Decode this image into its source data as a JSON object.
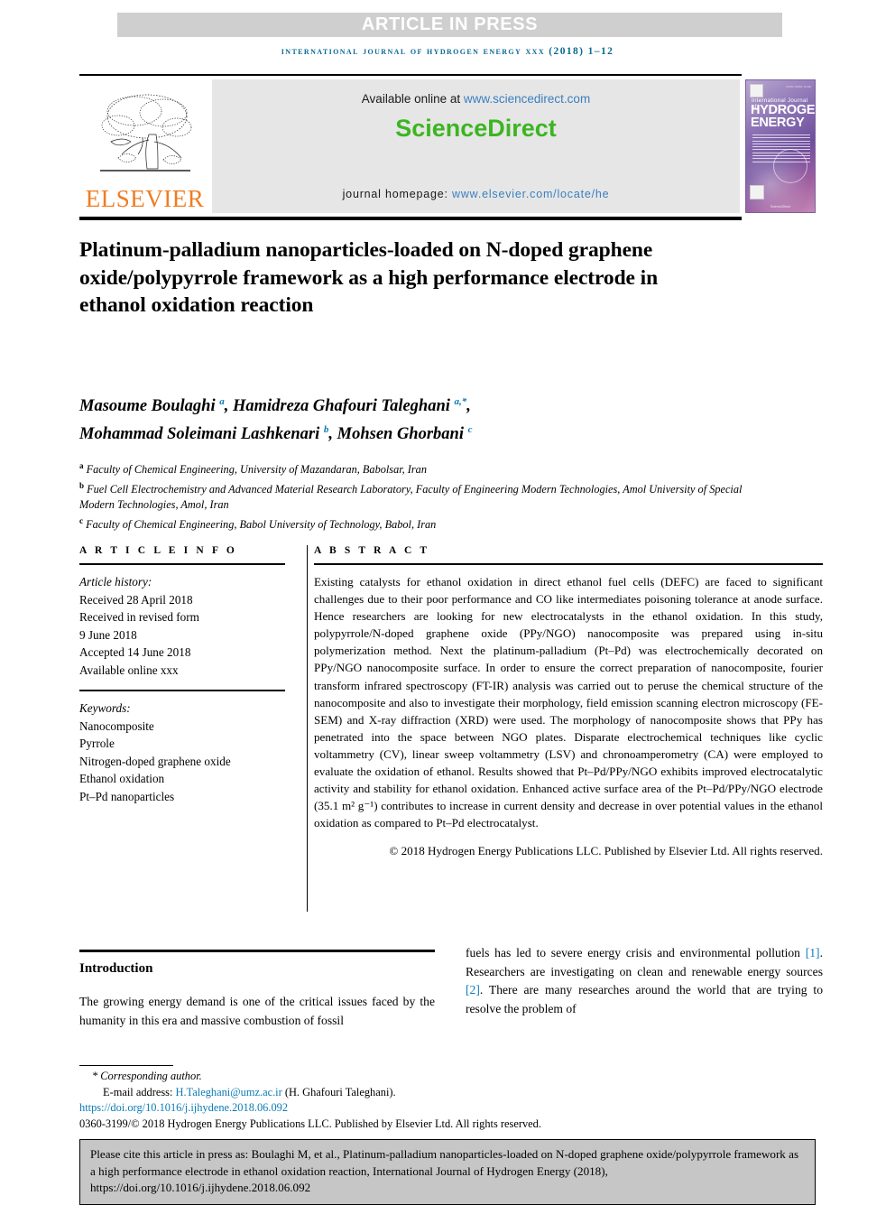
{
  "banner": {
    "article_in_press": "ARTICLE IN PRESS"
  },
  "running_head": "international journal of hydrogen energy xxx (2018) 1–12",
  "masthead": {
    "publisher_name": "ELSEVIER",
    "available_online_label": "Available online at ",
    "available_online_link": "www.sciencedirect.com",
    "sciencedirect_logo_a": "Science",
    "sciencedirect_logo_b": "Direct",
    "journal_homepage_label": "journal homepage: ",
    "journal_homepage_link": "www.elsevier.com/locate/he",
    "cover": {
      "top_right_code": "ISSN 0360-3199",
      "line_small": "International Journal of",
      "line_big_1": "HYDROGEN",
      "line_big_2": "ENERGY",
      "footer": "ScienceDirect"
    }
  },
  "article": {
    "title": "Platinum-palladium nanoparticles-loaded on N-doped graphene oxide/polypyrrole framework as a high performance electrode in ethanol oxidation reaction",
    "authors_line_1_a": "Masoume Boulaghi ",
    "authors_sup_1": "a",
    "authors_line_1_b": ", Hamidreza Ghafouri Taleghani ",
    "authors_sup_2": "a,*",
    "authors_line_1_c": ",",
    "authors_line_2_a": "Mohammad Soleimani Lashkenari ",
    "authors_sup_3": "b",
    "authors_line_2_b": ", Mohsen Ghorbani ",
    "authors_sup_4": "c",
    "affiliations": [
      {
        "marker": "a",
        "text": "Faculty of Chemical Engineering, University of Mazandaran, Babolsar, Iran"
      },
      {
        "marker": "b",
        "text": "Fuel Cell Electrochemistry and Advanced Material Research Laboratory, Faculty of Engineering Modern Technologies, Amol University of Special Modern Technologies, Amol, Iran"
      },
      {
        "marker": "c",
        "text": "Faculty of Chemical Engineering, Babol University of Technology, Babol, Iran"
      }
    ]
  },
  "article_info": {
    "section_label": "A R T I C L E   I N F O",
    "history_label": "Article history:",
    "received": "Received 28 April 2018",
    "revised_label": "Received in revised form",
    "revised_date": "9 June 2018",
    "accepted": "Accepted 14 June 2018",
    "available_online": "Available online xxx",
    "keywords_label": "Keywords:",
    "keywords": [
      "Nanocomposite",
      "Pyrrole",
      "Nitrogen-doped graphene oxide",
      "Ethanol oxidation",
      "Pt–Pd nanoparticles"
    ]
  },
  "abstract": {
    "section_label": "A B S T R A C T",
    "text": "Existing catalysts for ethanol oxidation in direct ethanol fuel cells (DEFC) are faced to significant challenges due to their poor performance and CO like intermediates poisoning tolerance at anode surface. Hence researchers are looking for new electrocatalysts in the ethanol oxidation. In this study, polypyrrole/N-doped graphene oxide (PPy/NGO) nanocomposite was prepared using in-situ polymerization method. Next the platinum-palladium (Pt–Pd) was electrochemically decorated on PPy/NGO nanocomposite surface. In order to ensure the correct preparation of nanocomposite, fourier transform infrared spectroscopy (FT-IR) analysis was carried out to peruse the chemical structure of the nanocomposite and also to investigate their morphology, field emission scanning electron microscopy (FE-SEM) and X-ray diffraction (XRD) were used. The morphology of nanocomposite shows that PPy has penetrated into the space between NGO plates. Disparate electrochemical techniques like cyclic voltammetry (CV), linear sweep voltammetry (LSV) and chronoamperometry (CA) were employed to evaluate the oxidation of ethanol. Results showed that Pt–Pd/PPy/NGO exhibits improved electrocatalytic activity and stability for ethanol oxidation. Enhanced active surface area of the Pt–Pd/PPy/NGO electrode (35.1 m² g⁻¹) contributes to increase in current density and decrease in over potential values in the ethanol oxidation as compared to Pt–Pd electrocatalyst.",
    "copyright": "© 2018 Hydrogen Energy Publications LLC. Published by Elsevier Ltd. All rights reserved."
  },
  "introduction": {
    "heading": "Introduction",
    "left_paragraph": "The growing energy demand is one of the critical issues faced by the humanity in this era and massive combustion of fossil",
    "right_paragraph_a": "fuels has led to severe energy crisis and environmental pollution ",
    "right_ref_1": "[1]",
    "right_paragraph_b": ". Researchers are investigating on clean and renewable energy sources ",
    "right_ref_2": "[2]",
    "right_paragraph_c": ". There are many researches around the world that are trying to resolve the problem of"
  },
  "footnotes": {
    "corresponding_author": "* Corresponding author.",
    "email_label": "E-mail address: ",
    "email": "H.Taleghani@umz.ac.ir",
    "email_suffix": " (H. Ghafouri Taleghani).",
    "doi": "https://doi.org/10.1016/j.ijhydene.2018.06.092",
    "issn_line": "0360-3199/© 2018 Hydrogen Energy Publications LLC. Published by Elsevier Ltd. All rights reserved."
  },
  "citation_box": {
    "text": "Please cite this article in press as: Boulaghi M, et al., Platinum-palladium nanoparticles-loaded on N-doped graphene oxide/polypyrrole framework as a high performance electrode in ethanol oxidation reaction, International Journal of Hydrogen Energy (2018), https://doi.org/10.1016/j.ijhydene.2018.06.092"
  },
  "colors": {
    "accent_teal": "#0b7bb5",
    "elsevier_orange": "#ef7d22",
    "sciencedirect_green": "#3cb521",
    "banner_gray": "#cfcfcf",
    "box_gray": "#c6c6c6"
  }
}
